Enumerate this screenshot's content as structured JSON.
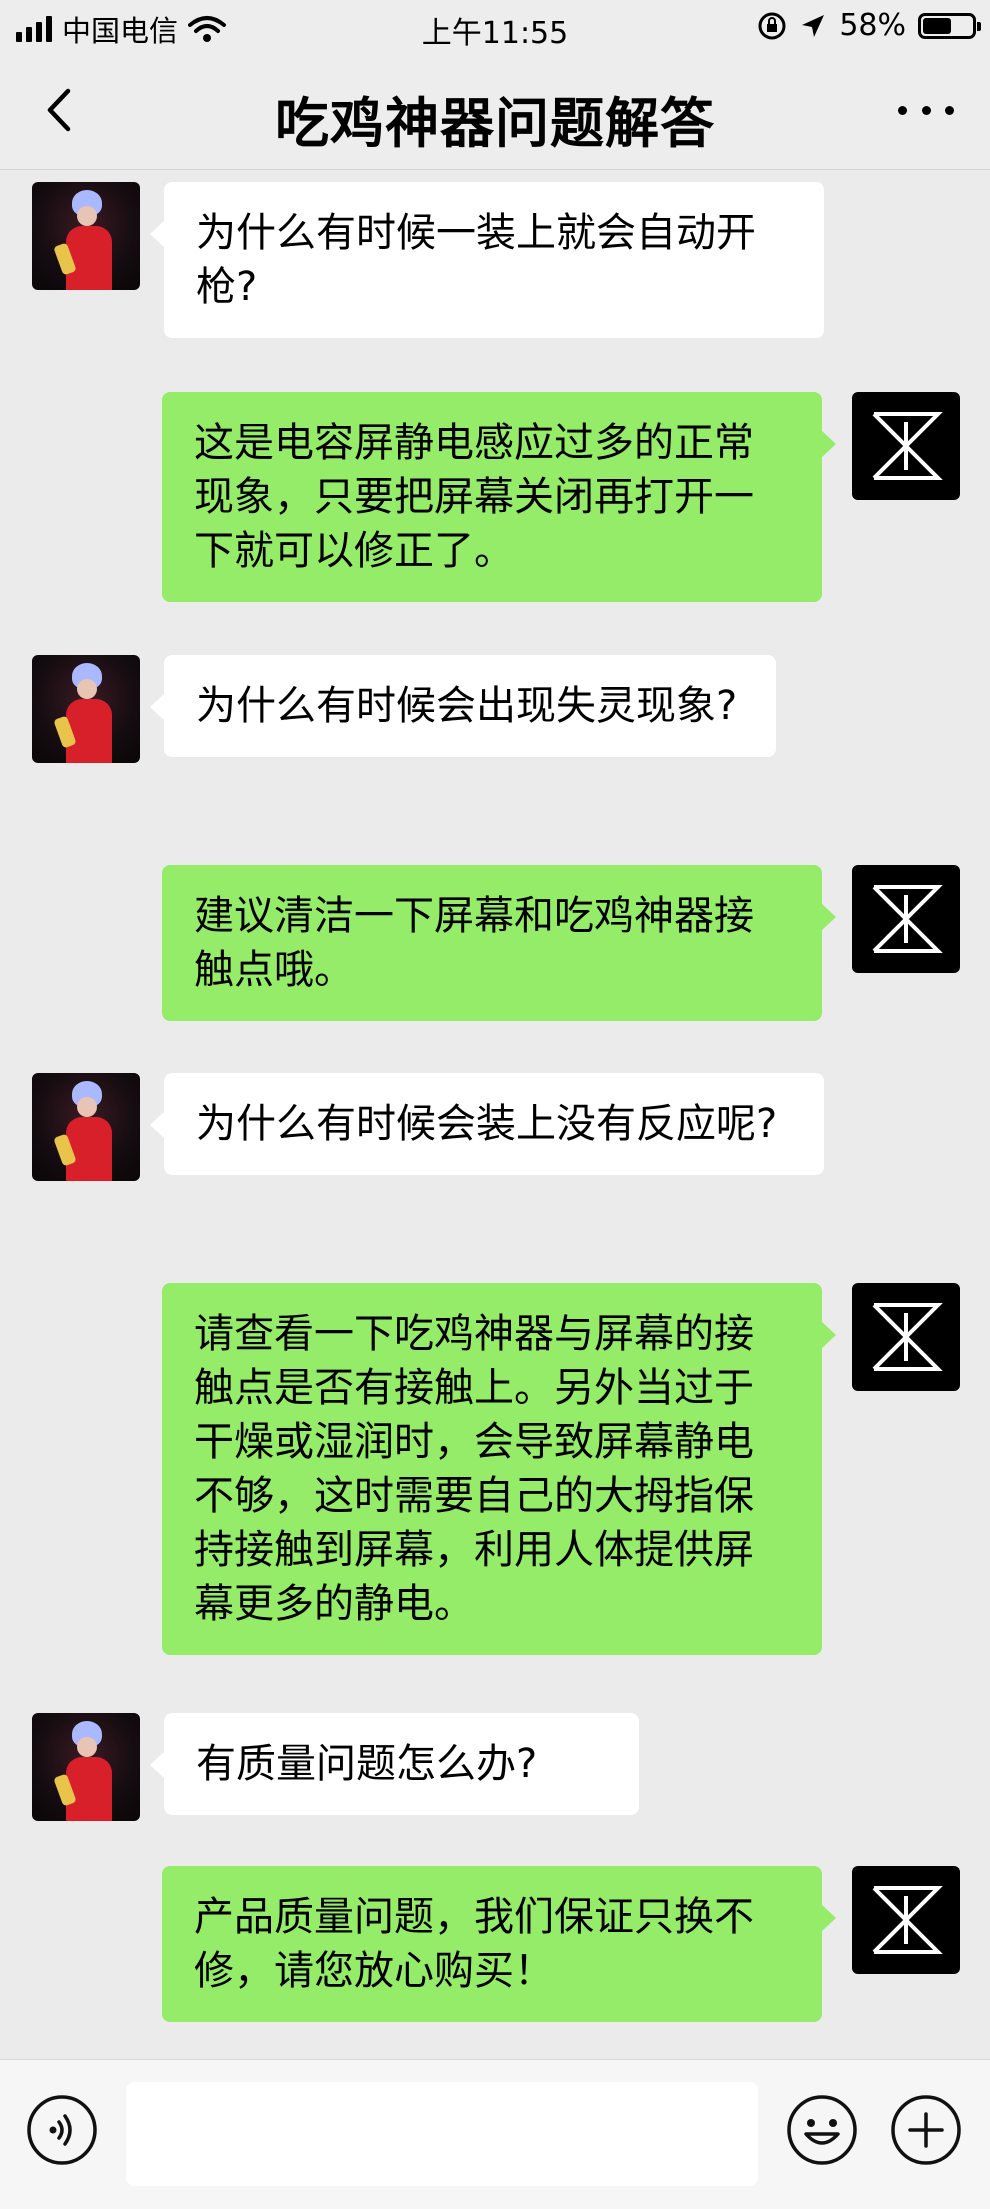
{
  "status_bar": {
    "carrier": "中国电信",
    "time": "上午11:55",
    "battery_percent_label": "58%",
    "battery_level": 0.58
  },
  "nav": {
    "title": "吃鸡神器问题解答"
  },
  "messages": [
    {
      "side": "left",
      "text": "为什么有时候一装上就会自动开枪?"
    },
    {
      "side": "right",
      "text": "这是电容屏静电感应过多的正常现象，只要把屏幕关闭再打开一下就可以修正了。"
    },
    {
      "side": "left",
      "text": "为什么有时候会出现失灵现象?"
    },
    {
      "side": "right",
      "text": "建议清洁一下屏幕和吃鸡神器接触点哦。"
    },
    {
      "side": "left",
      "text": "为什么有时候会装上没有反应呢?"
    },
    {
      "side": "right",
      "text": "请查看一下吃鸡神器与屏幕的接触点是否有接触上。另外当过于干燥或湿润时，会导致屏幕静电不够，这时需要自己的大拇指保持接触到屏幕，利用人体提供屏幕更多的静电。"
    },
    {
      "side": "left",
      "text": "有质量问题怎么办?"
    },
    {
      "side": "right",
      "text": "产品质量问题，我们保证只换不修，请您放心购买！"
    }
  ],
  "colors": {
    "bubble_self": "#95ec69",
    "bubble_other": "#ffffff",
    "background": "#ebebeb"
  },
  "icons": {
    "back": "chevron-left-icon",
    "more": "more-dots-icon",
    "voice": "voice-icon",
    "emoji": "emoji-icon",
    "plus": "plus-icon"
  },
  "input": {
    "value": "",
    "placeholder": ""
  }
}
